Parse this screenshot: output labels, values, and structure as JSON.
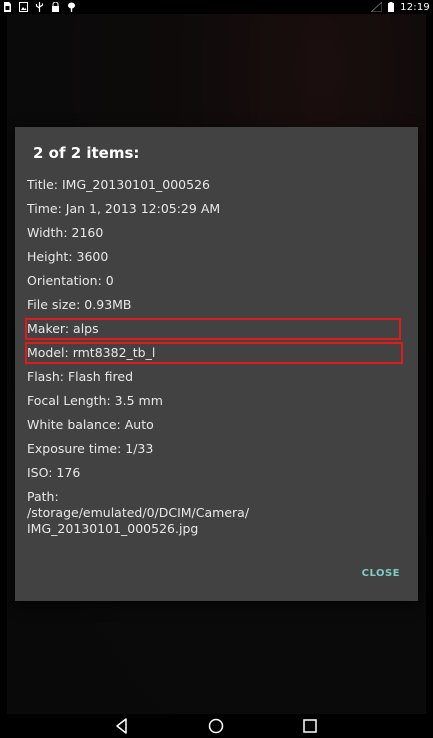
{
  "status_bar": {
    "time": "12:19",
    "left_icons": [
      "sim-card-icon",
      "image-icon",
      "usb-icon",
      "lock-icon",
      "bug-report-icon"
    ],
    "right_icons": [
      "signal-icon",
      "battery-icon"
    ]
  },
  "dialog": {
    "title": "2 of 2 items:",
    "rows": [
      "Title: IMG_20130101_000526",
      "Time: Jan 1, 2013 12:05:29 AM",
      "Width: 2160",
      "Height: 3600",
      "Orientation: 0",
      "File size: 0.93MB",
      "Maker: alps",
      "Model: rmt8382_tb_l",
      "Flash: Flash fired",
      "Focal Length: 3.5 mm",
      "White balance: Auto",
      "Exposure time: 1/33",
      "ISO: 176"
    ],
    "path": "Path:\n/storage/emulated/0/DCIM/Camera/\nIMG_20130101_000526.jpg",
    "close_label": "CLOSE",
    "highlight_color": "#e01b1b",
    "accent_color": "#80cbc4"
  },
  "nav_bar": {
    "icons": [
      "back-icon",
      "home-icon",
      "recents-icon"
    ]
  }
}
